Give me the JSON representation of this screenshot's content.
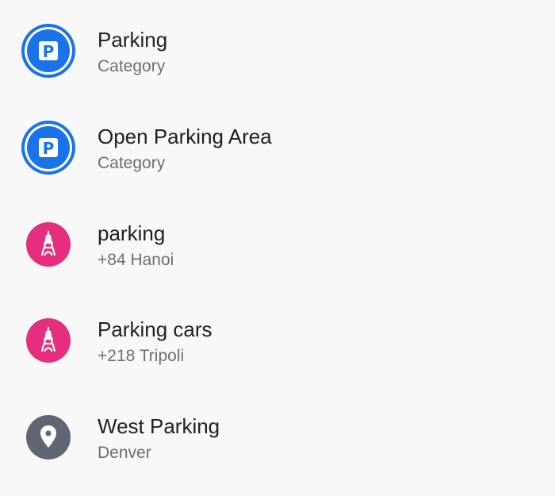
{
  "colors": {
    "background": "#f8f8f8",
    "category_blue": "#1a73e8",
    "landmark_pink": "#e52e7d",
    "place_gray": "#5f6673",
    "title_text": "#202124",
    "subtitle_text": "#6f6f6f"
  },
  "results": [
    {
      "title": "Parking",
      "subtitle": "Category",
      "icon": "parking-category-icon",
      "icon_glyph": "P"
    },
    {
      "title": "Open Parking Area",
      "subtitle": "Category",
      "icon": "parking-category-icon",
      "icon_glyph": "P"
    },
    {
      "title": "parking",
      "subtitle": "+84 Hanoi",
      "icon": "eiffel-tower-icon"
    },
    {
      "title": "Parking cars",
      "subtitle": "+218 Tripoli",
      "icon": "eiffel-tower-icon"
    },
    {
      "title": "West Parking",
      "subtitle": "Denver",
      "icon": "map-pin-icon"
    }
  ]
}
